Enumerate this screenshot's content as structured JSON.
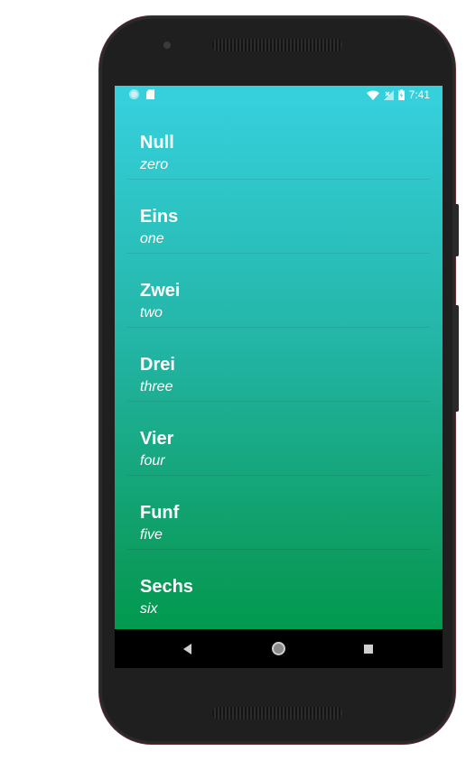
{
  "status_bar": {
    "time": "7:41",
    "icons": [
      "notification-circle-icon",
      "sd-card-icon",
      "wifi-icon",
      "signal-icon",
      "battery-icon"
    ]
  },
  "colors": {
    "gradient_top": "#35cfdb",
    "gradient_bottom": "#009a4e",
    "text": "#ffffff",
    "navbar": "#000000"
  },
  "numbers": [
    {
      "german": "Null",
      "english": "zero"
    },
    {
      "german": "Eins",
      "english": "one"
    },
    {
      "german": "Zwei",
      "english": "two"
    },
    {
      "german": "Drei",
      "english": "three"
    },
    {
      "german": "Vier",
      "english": "four"
    },
    {
      "german": "Funf",
      "english": "five"
    },
    {
      "german": "Sechs",
      "english": "six"
    }
  ],
  "nav_bar": {
    "buttons": [
      "back-icon",
      "home-icon",
      "recents-icon"
    ]
  }
}
